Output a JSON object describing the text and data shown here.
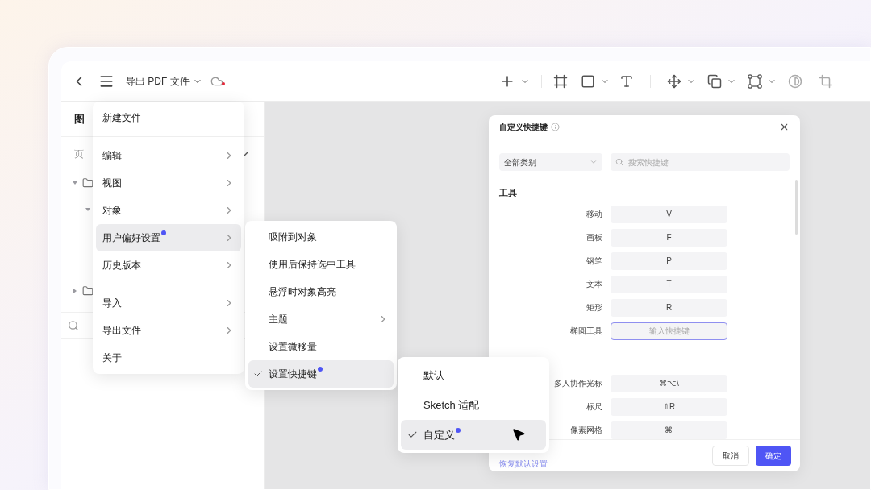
{
  "toolbar": {
    "title": "导出 PDF 文件"
  },
  "sidebar": {
    "tab": "图",
    "page_label": "页",
    "tree": [
      {
        "expanded": true,
        "children": [
          {
            "expanded": true
          }
        ]
      },
      {
        "expanded": false
      }
    ]
  },
  "main_menu": {
    "groups": [
      {
        "items": [
          {
            "label": "新建文件",
            "submenu": false,
            "selected": false,
            "dot": false
          }
        ]
      },
      {
        "items": [
          {
            "label": "编辑",
            "submenu": true,
            "selected": false,
            "dot": false
          },
          {
            "label": "视图",
            "submenu": true,
            "selected": false,
            "dot": false
          },
          {
            "label": "对象",
            "submenu": true,
            "selected": false,
            "dot": false
          },
          {
            "label": "用户偏好设置",
            "submenu": true,
            "selected": true,
            "dot": true
          },
          {
            "label": "历史版本",
            "submenu": true,
            "selected": false,
            "dot": false
          }
        ]
      },
      {
        "items": [
          {
            "label": "导入",
            "submenu": true,
            "selected": false,
            "dot": false
          },
          {
            "label": "导出文件",
            "submenu": true,
            "selected": false,
            "dot": false
          },
          {
            "label": "关于",
            "submenu": false,
            "selected": false,
            "dot": false
          }
        ]
      }
    ]
  },
  "preferences_menu": {
    "items": [
      {
        "label": "吸附到对象",
        "submenu": false,
        "selected": false,
        "checked": false,
        "dot": false
      },
      {
        "label": "使用后保持选中工具",
        "submenu": false,
        "selected": false,
        "checked": false,
        "dot": false
      },
      {
        "label": "悬浮时对象高亮",
        "submenu": false,
        "selected": false,
        "checked": false,
        "dot": false
      },
      {
        "label": "主题",
        "submenu": true,
        "selected": false,
        "checked": false,
        "dot": false
      },
      {
        "label": "设置微移量",
        "submenu": false,
        "selected": false,
        "checked": false,
        "dot": false
      },
      {
        "label": "设置快捷键",
        "submenu": false,
        "selected": true,
        "checked": true,
        "dot": true
      }
    ]
  },
  "shortcut_scheme_menu": {
    "items": [
      {
        "label": "默认",
        "selected": false,
        "checked": false,
        "dot": false
      },
      {
        "label": "Sketch 适配",
        "selected": false,
        "checked": false,
        "dot": false
      },
      {
        "label": "自定义",
        "selected": true,
        "checked": true,
        "dot": true
      }
    ]
  },
  "dialog": {
    "title": "自定义快捷键",
    "category": "全部类别",
    "search_placeholder": "搜索快捷键",
    "sections": [
      {
        "title": "工具",
        "rows": [
          {
            "label": "移动",
            "key": "V",
            "focused": false
          },
          {
            "label": "画板",
            "key": "F",
            "focused": false
          },
          {
            "label": "钢笔",
            "key": "P",
            "focused": false
          },
          {
            "label": "文本",
            "key": "T",
            "focused": false
          },
          {
            "label": "矩形",
            "key": "R",
            "focused": false
          },
          {
            "label": "椭圆工具",
            "placeholder": "输入快捷键",
            "focused": true
          }
        ]
      },
      {
        "rows": [
          {
            "label": "多人协作光标",
            "key": "⌘⌥\\",
            "focused": false
          },
          {
            "label": "标尺",
            "key": "⇧R",
            "focused": false
          },
          {
            "label": "像素网格",
            "key": "⌘'",
            "focused": false
          }
        ]
      }
    ],
    "reset_link": "恢复默认设置",
    "buttons": [
      {
        "label": "取消",
        "kind": "secondary"
      },
      {
        "label": "确定",
        "kind": "primary"
      }
    ]
  }
}
